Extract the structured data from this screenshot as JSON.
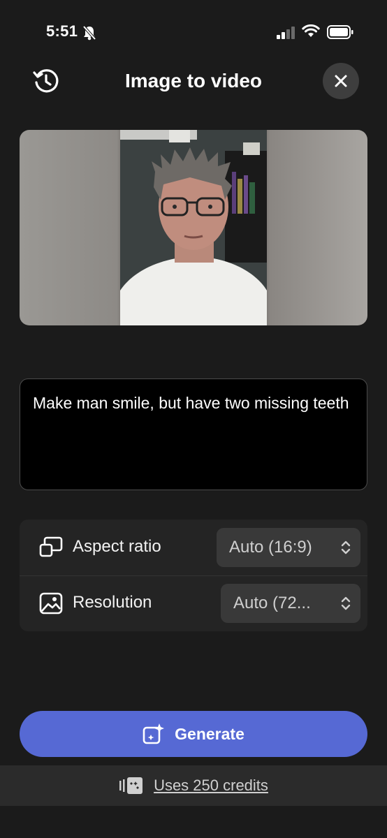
{
  "status_bar": {
    "time": "5:51"
  },
  "header": {
    "title": "Image to video"
  },
  "prompt": {
    "text": "Make man smile, but have two missing teeth"
  },
  "settings": {
    "aspect_ratio": {
      "label": "Aspect ratio",
      "value": "Auto (16:9)"
    },
    "resolution": {
      "label": "Resolution",
      "value": "Auto (72..."
    }
  },
  "generate": {
    "label": "Generate"
  },
  "credits": {
    "label": "Uses 250 credits"
  },
  "colors": {
    "accent": "#5669d4",
    "background": "#1b1b1b"
  }
}
